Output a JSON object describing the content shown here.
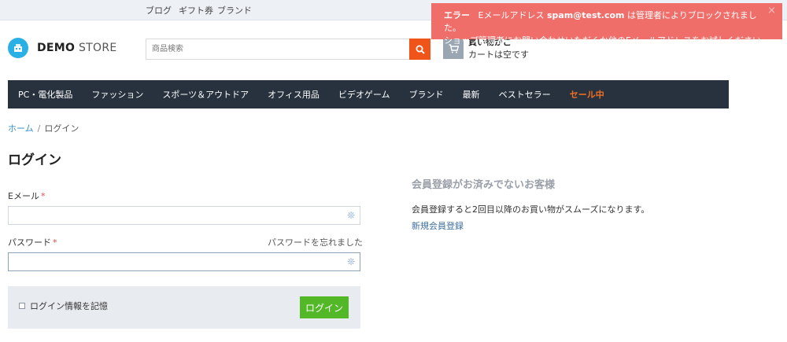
{
  "topbar": {
    "links": [
      "ブログ",
      "ギフト券",
      "ブランド"
    ]
  },
  "logo": {
    "strong": "DEMO",
    "light": "STORE"
  },
  "search": {
    "placeholder": "商品検索",
    "icon": "search-icon"
  },
  "cart": {
    "title": "買い物かご",
    "status": "カートは空です",
    "icon": "cart-icon"
  },
  "alert": {
    "label": "エラー",
    "text_before": "Eメールアドレス",
    "email": "spam@test.com",
    "text_after": "は管理者によりブロックされました。",
    "line2": "ショップ管理者にお問い合わせいただくか他のEメールアドレスをお試しください。",
    "close": "×",
    "bg_color": "#ef6e69"
  },
  "nav": {
    "items": [
      "PC・電化製品",
      "ファッション",
      "スポーツ＆アウトドア",
      "オフィス用品",
      "ビデオゲーム",
      "ブランド",
      "最新",
      "ベストセラー"
    ],
    "sale": "セール中",
    "bg_color": "#28323f",
    "sale_color": "#f26f22"
  },
  "breadcrumb": {
    "home": "ホーム",
    "separator": "/",
    "current": "ログイン"
  },
  "page_title": "ログイン",
  "form": {
    "email_label": "Eメール",
    "password_label": "パスワード",
    "required_mark": "*",
    "forgot_link": "パスワードを忘れました",
    "remember_label": "ログイン情報を記憶",
    "login_button": "ログイン",
    "field_icon": "snowflake-icon",
    "login_button_color": "#53b827"
  },
  "register": {
    "title": "会員登録がお済みでないお客様",
    "description": "会員登録すると2回目以降のお買い物がスムーズになります。",
    "link": "新規会員登録"
  }
}
